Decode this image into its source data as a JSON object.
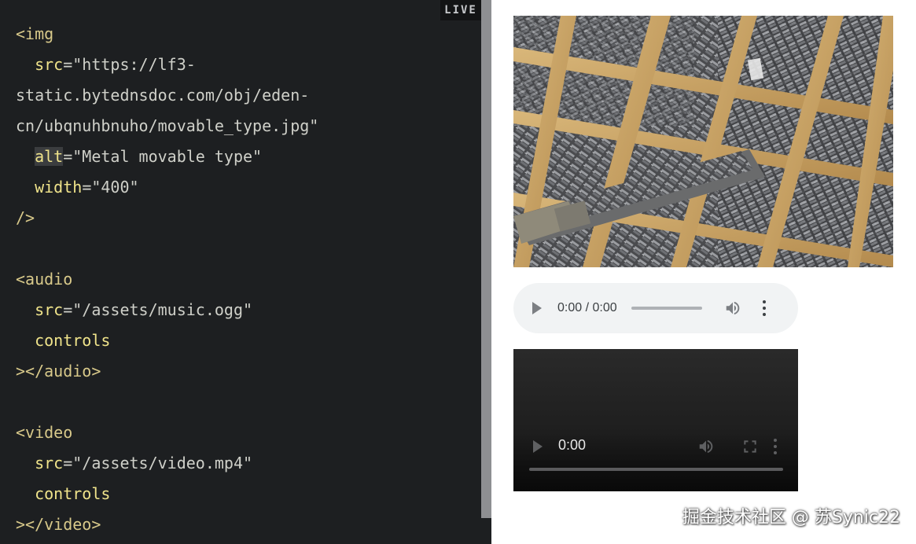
{
  "editor": {
    "live_label": "LIVE",
    "lines": [
      {
        "parts": [
          {
            "t": "<img",
            "c": "tag"
          }
        ]
      },
      {
        "parts": [
          {
            "t": "  ",
            "c": "punct"
          },
          {
            "t": "src",
            "c": "attr"
          },
          {
            "t": "=\"https://lf3-",
            "c": "str"
          }
        ]
      },
      {
        "parts": [
          {
            "t": "static.bytednsdoc.com/obj/eden-",
            "c": "str"
          }
        ]
      },
      {
        "parts": [
          {
            "t": "cn/ubqnuhbnuho/movable_type.jpg\"",
            "c": "str"
          }
        ]
      },
      {
        "parts": [
          {
            "t": "  ",
            "c": "punct"
          },
          {
            "t": "alt",
            "c": "attr cursor-hl"
          },
          {
            "t": "=\"Metal movable type\"",
            "c": "str"
          }
        ]
      },
      {
        "parts": [
          {
            "t": "  ",
            "c": "punct"
          },
          {
            "t": "width",
            "c": "attr"
          },
          {
            "t": "=\"400\"",
            "c": "str"
          }
        ]
      },
      {
        "parts": [
          {
            "t": "/>",
            "c": "tag"
          }
        ]
      },
      {
        "parts": [
          {
            "t": "",
            "c": "punct"
          }
        ]
      },
      {
        "parts": [
          {
            "t": "<audio",
            "c": "tag"
          }
        ]
      },
      {
        "parts": [
          {
            "t": "  ",
            "c": "punct"
          },
          {
            "t": "src",
            "c": "attr"
          },
          {
            "t": "=\"/assets/music.ogg\"",
            "c": "str"
          }
        ]
      },
      {
        "parts": [
          {
            "t": "  ",
            "c": "punct"
          },
          {
            "t": "controls",
            "c": "attr"
          }
        ]
      },
      {
        "parts": [
          {
            "t": "></audio>",
            "c": "tag"
          }
        ]
      },
      {
        "parts": [
          {
            "t": "",
            "c": "punct"
          }
        ]
      },
      {
        "parts": [
          {
            "t": "<video",
            "c": "tag"
          }
        ]
      },
      {
        "parts": [
          {
            "t": "  ",
            "c": "punct"
          },
          {
            "t": "src",
            "c": "attr"
          },
          {
            "t": "=\"/assets/video.mp4\"",
            "c": "str"
          }
        ]
      },
      {
        "parts": [
          {
            "t": "  ",
            "c": "punct"
          },
          {
            "t": "controls",
            "c": "attr"
          }
        ]
      },
      {
        "parts": [
          {
            "t": "></video>",
            "c": "tag"
          }
        ]
      }
    ]
  },
  "preview": {
    "image_alt": "Metal movable type",
    "audio": {
      "time": "0:00 / 0:00",
      "play_icon": "play-icon",
      "volume_icon": "volume-icon",
      "menu_icon": "more-vert-icon"
    },
    "video": {
      "time": "0:00",
      "play_icon": "play-icon",
      "volume_icon": "volume-icon",
      "fullscreen_icon": "fullscreen-icon",
      "menu_icon": "more-vert-icon"
    }
  },
  "watermark": "掘金技术社区 @ 苏Synic22",
  "colors": {
    "editor_bg": "#1d1f21",
    "divider": "#8e8f92",
    "audio_bg": "#f1f3f4",
    "tag": "#d8c98a",
    "attr": "#f0e48b"
  }
}
